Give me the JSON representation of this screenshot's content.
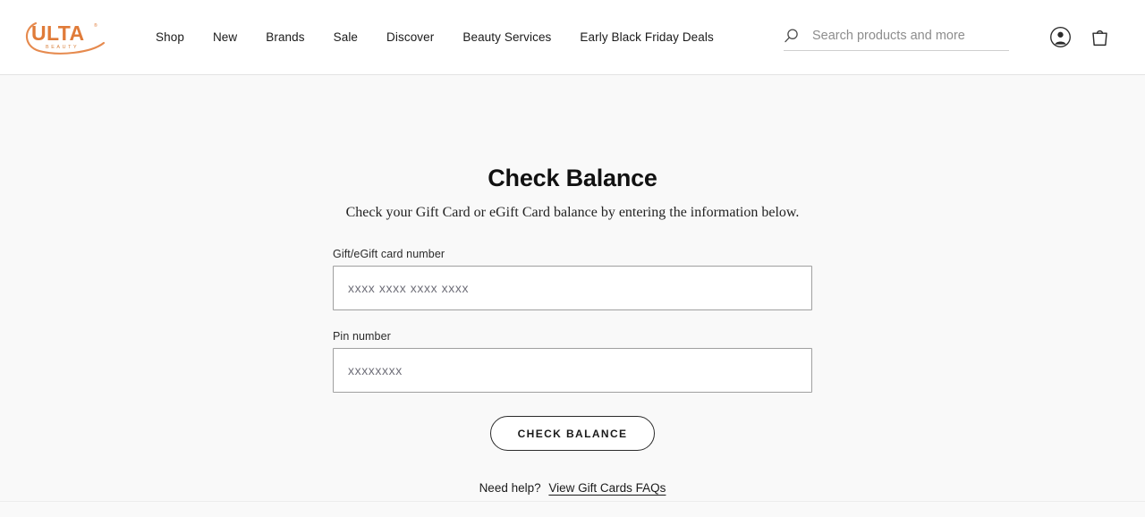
{
  "header": {
    "logo": {
      "name": "ulta-beauty-logo",
      "wordmark": "ULTA",
      "tagline": "BEAUTY",
      "trademark": "®",
      "color": "#E07B39"
    },
    "nav": [
      {
        "label": "Shop"
      },
      {
        "label": "New"
      },
      {
        "label": "Brands"
      },
      {
        "label": "Sale"
      },
      {
        "label": "Discover"
      },
      {
        "label": "Beauty Services"
      },
      {
        "label": "Early Black Friday Deals"
      }
    ],
    "search": {
      "icon": "search-icon",
      "placeholder": "Search products and more",
      "value": ""
    },
    "account_icon": "account-icon",
    "bag_icon": "shopping-bag-icon"
  },
  "main": {
    "title": "Check Balance",
    "subtitle": "Check your Gift Card or eGift Card balance by entering the information below.",
    "fields": [
      {
        "label": "Gift/eGift card number",
        "placeholder": "xxxx xxxx xxxx xxxx",
        "value": ""
      },
      {
        "label": "Pin number",
        "placeholder": "xxxxxxxx",
        "value": ""
      }
    ],
    "submit_label": "CHECK BALANCE",
    "help_text": "Need help?",
    "help_link_label": "View Gift Cards FAQs"
  },
  "colors": {
    "brand_orange": "#E07B39",
    "page_background": "#f9f9f9",
    "header_background": "#ffffff",
    "text": "#1a1a1a",
    "input_border": "#a0a0a0"
  }
}
